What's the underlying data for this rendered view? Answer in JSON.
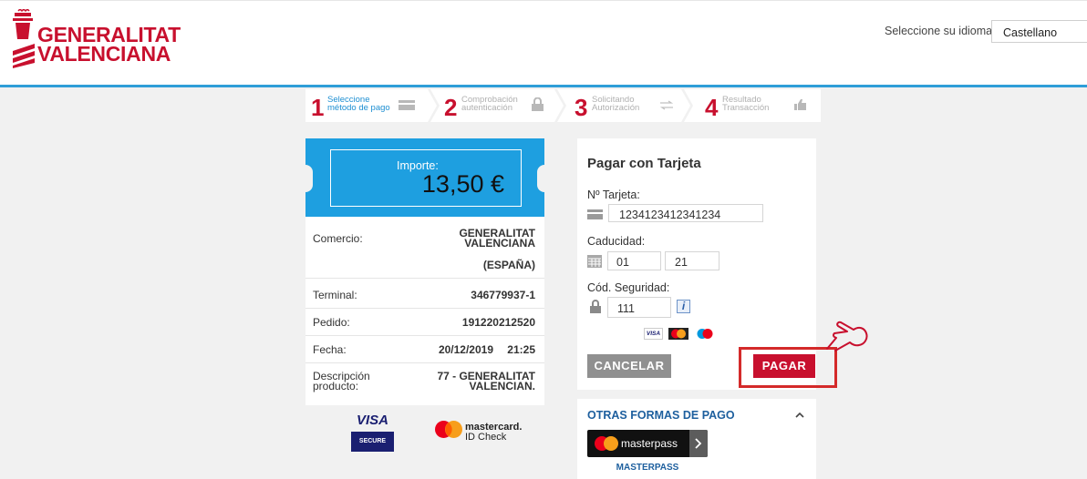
{
  "header": {
    "logo_line1": "GENERALITAT",
    "logo_line2": "VALENCIANA",
    "language_label": "Seleccione su idioma",
    "language_value": "Castellano"
  },
  "steps": [
    {
      "number": "1",
      "line1": "Seleccione",
      "line2": "método de pago",
      "icon": "card-icon",
      "active": true
    },
    {
      "number": "2",
      "line1": "Comprobación",
      "line2": "autenticación",
      "icon": "lock-icon",
      "active": false
    },
    {
      "number": "3",
      "line1": "Solicitando",
      "line2": "Autorización",
      "icon": "transfer-icon",
      "active": false
    },
    {
      "number": "4",
      "line1": "Resultado",
      "line2": "Transacción",
      "icon": "thumbs-up-icon",
      "active": false
    }
  ],
  "amount": {
    "label": "Importe:",
    "value": "13,50 €"
  },
  "details": {
    "comercio_label": "Comercio:",
    "comercio_value_line1": "GENERALITAT",
    "comercio_value_line2": "VALENCIANA",
    "comercio_country": "(ESPAÑA)",
    "terminal_label": "Terminal:",
    "terminal_value": "346779937-1",
    "pedido_label": "Pedido:",
    "pedido_value": "191220212520",
    "fecha_label": "Fecha:",
    "fecha_value": "20/12/2019",
    "hora_value": "21:25",
    "descripcion_label_line1": "Descripción",
    "descripcion_label_line2": "producto:",
    "descripcion_value_line1": "77 - GENERALITAT",
    "descripcion_value_line2": "VALENCIAN."
  },
  "badges": {
    "visa_line1": "VISA",
    "visa_line2": "SECURE",
    "mastercard_line1": "mastercard.",
    "mastercard_line2": "ID Check"
  },
  "payment_form": {
    "title": "Pagar con Tarjeta",
    "card_number_label": "Nº Tarjeta:",
    "card_number_value": "1234123412341234",
    "expiry_label": "Caducidad:",
    "expiry_month": "01",
    "expiry_year": "21",
    "cvv_label": "Cód. Seguridad:",
    "cvv_value": "111",
    "info_icon_text": "i",
    "card_logos": [
      "VISA",
      "mastercard",
      "maestro"
    ],
    "cancel_label": "CANCELAR",
    "pay_label": "PAGAR"
  },
  "other_methods": {
    "title": "OTRAS FORMAS DE PAGO",
    "masterpass_button_text": "masterpass",
    "masterpass_label": "MASTERPASS"
  },
  "colors": {
    "brand_red": "#c8102e",
    "accent_blue": "#1e9fe0",
    "header_line": "#2f9ed8",
    "cancel_gray": "#909090"
  }
}
